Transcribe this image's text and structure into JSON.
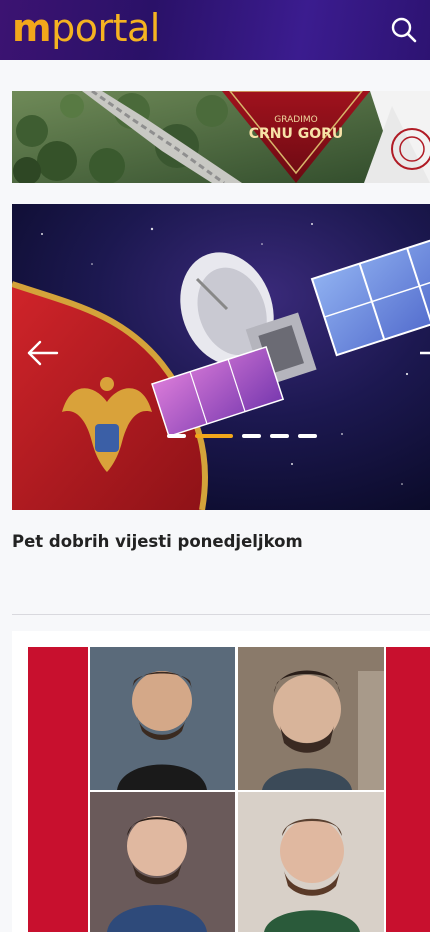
{
  "header": {
    "logo_highlight": "m",
    "logo_rest": "portal",
    "search_icon": "search-icon",
    "background_color": "#2a1168",
    "accent_color": "#f2a71b"
  },
  "ad_banner": {
    "kicker": "GRADIMO",
    "title_line1": "CRNU GORU"
  },
  "slider": {
    "headline": "Pet dobrih vijesti ponedjeljkom",
    "prev_icon": "arrow-left-icon",
    "next_icon": "arrow-right-icon",
    "dots_total": 5,
    "active_dot": 2
  },
  "article_card": {
    "image_icon": "photo-collage"
  }
}
